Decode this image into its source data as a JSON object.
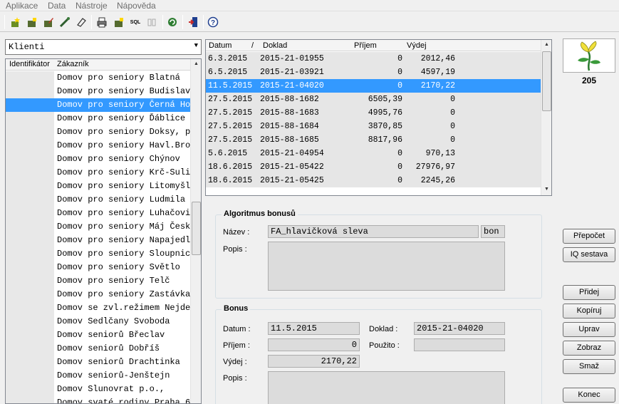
{
  "menu": [
    "Aplikace",
    "Data",
    "Nástroje",
    "Nápověda"
  ],
  "toolbar": {
    "icons": [
      "new-icon",
      "open-icon",
      "edit-icon",
      "wand-icon",
      "eraser-icon",
      "print-icon",
      "sql-icon",
      "columns-icon",
      "refresh-icon",
      "exit-icon",
      "help-icon"
    ],
    "sql_label": "SQL"
  },
  "client_panel": {
    "selector_value": "Klienti",
    "columns": [
      "Identifikátor",
      "Zákazník"
    ],
    "rows": [
      "Domov pro seniory Blatná",
      "Domov pro seniory Budislav",
      "Domov pro seniory Černá Hor",
      "Domov pro seniory Ďáblice",
      "Domov pro seniory Doksy, př",
      "Domov pro seniory Havl.Brod",
      "Domov pro seniory Chýnov",
      "Domov pro seniory Krč-Sulic",
      "Domov pro seniory Litomyšl",
      "Domov pro seniory Ludmila H",
      "Domov pro seniory Luhačovic",
      "Domov pro seniory Máj České",
      "Domov pro seniory Napajedla",
      "Domov pro seniory Sloupnice",
      "Domov pro seniory Světlo",
      "Domov pro seniory Telč",
      "Domov pro seniory Zastávka",
      "Domov se zvl.režimem Nejdek",
      "Domov Sedlčany Svoboda",
      "Domov seniorů Břeclav",
      "Domov seniorů Dobříš",
      "Domov seniorů Drachtinka",
      "Domov seniorů-Jenštejn",
      "Domov Slunovrat p.o.,",
      "Domov svaté rodiny Praha 6"
    ],
    "selected_index": 2
  },
  "documents": {
    "columns": [
      "Datum",
      "Doklad",
      "Příjem",
      "Výdej"
    ],
    "sort_marker": "/",
    "rows": [
      [
        "6.3.2015",
        "2015-21-01955",
        "0",
        "2012,46"
      ],
      [
        "6.5.2015",
        "2015-21-03921",
        "0",
        "4597,19"
      ],
      [
        "11.5.2015",
        "2015-21-04020",
        "0",
        "2170,22"
      ],
      [
        "27.5.2015",
        "2015-88-1682",
        "6505,39",
        "0"
      ],
      [
        "27.5.2015",
        "2015-88-1683",
        "4995,76",
        "0"
      ],
      [
        "27.5.2015",
        "2015-88-1684",
        "3870,85",
        "0"
      ],
      [
        "27.5.2015",
        "2015-88-1685",
        "8817,96",
        "0"
      ],
      [
        "5.6.2015",
        "2015-21-04954",
        "0",
        "970,13"
      ],
      [
        "18.6.2015",
        "2015-21-05422",
        "0",
        "27976,97"
      ],
      [
        "18.6.2015",
        "2015-21-05425",
        "0",
        "2245,26"
      ]
    ],
    "selected_index": 2
  },
  "algorithm": {
    "title": "Algoritmus bonusů",
    "name_label": "Název :",
    "name_value": "FA_hlavičková sleva",
    "code_value": "bon",
    "desc_label": "Popis :",
    "desc_value": ""
  },
  "bonus": {
    "title": "Bonus",
    "date_label": "Datum :",
    "date_value": "11.5.2015",
    "doc_label": "Doklad :",
    "doc_value": "2015-21-04020",
    "income_label": "Příjem :",
    "income_value": "0",
    "used_label": "Použito :",
    "used_value": "",
    "expense_label": "Výdej :",
    "expense_value": "2170,22",
    "desc_label": "Popis :",
    "desc_value": ""
  },
  "side": {
    "count": "205",
    "buttons": {
      "recalc": "Přepočet",
      "iq": "IQ sestava",
      "add": "Přidej",
      "copy": "Kopíruj",
      "edit": "Uprav",
      "show": "Zobraz",
      "delete": "Smaž",
      "end": "Konec"
    }
  }
}
